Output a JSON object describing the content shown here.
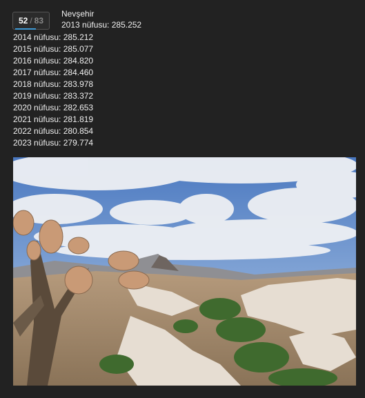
{
  "counter": {
    "current": "52",
    "separator": "/",
    "total": "83",
    "progress": 0.63
  },
  "header": {
    "title": "Nevşehir",
    "first_line": "2013 nüfusu: 285.252"
  },
  "population_lines": [
    "2014 nüfusu: 285.212",
    "2015 nüfusu: 285.077",
    "2016 nüfusu: 284.820",
    "2017 nüfusu: 284.460",
    "2018 nüfusu: 283.978",
    "2019 nüfusu: 283.372",
    "2020 nüfusu: 282.653",
    "2021 nüfusu: 281.819",
    "2022 nüfusu: 280.854",
    "2023 nüfusu: 279.774"
  ],
  "colors": {
    "background": "#222222",
    "accent": "#3f9bd6"
  }
}
